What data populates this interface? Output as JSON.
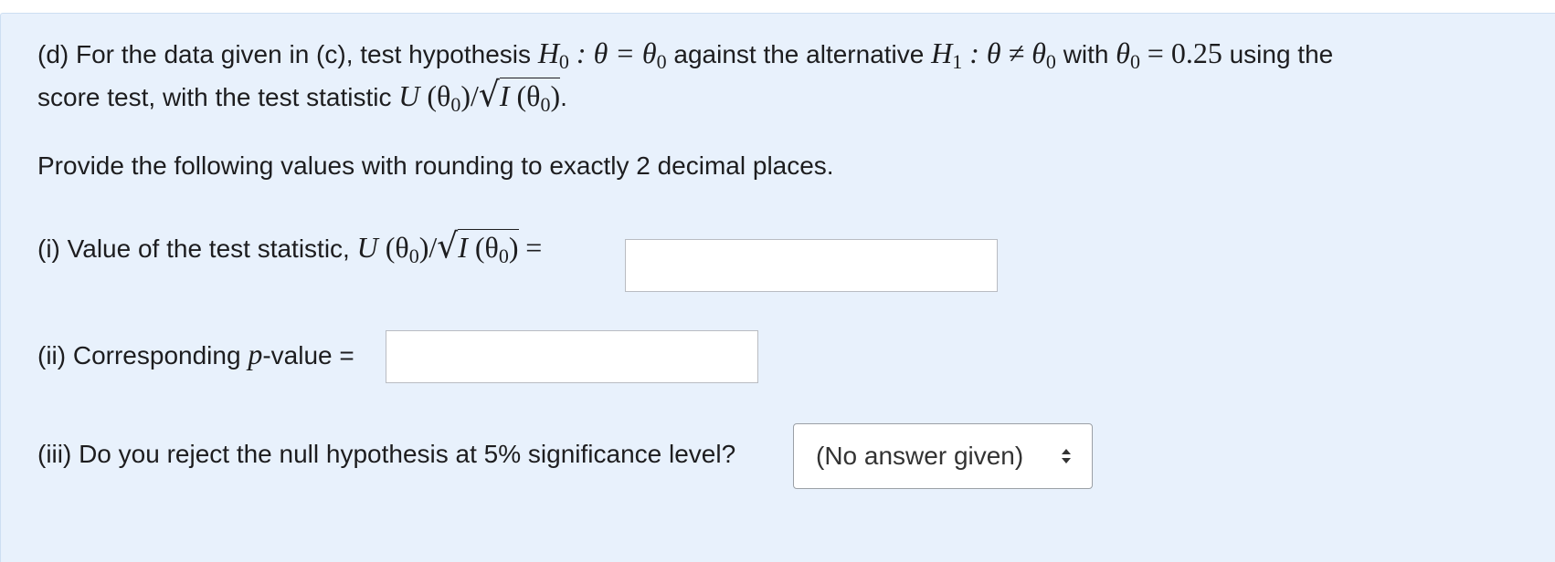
{
  "question": {
    "part_d_prefix": "(d) For the data given in (c), test hypothesis",
    "h0_symbol": "H",
    "h0_sub": "0",
    "h0_rel": " : θ = θ",
    "h0_theta_sub": "0",
    "against_text": "against the alternative",
    "h1_symbol": "H",
    "h1_sub": "1",
    "h1_rel": " : θ ≠ θ",
    "h1_theta_sub": "0",
    "with_text": "with",
    "theta0_symbol": "θ",
    "theta0_sub": "0",
    "theta0_value": "= 0.25",
    "using_text": "using the",
    "line2_text": "score test, with the test statistic",
    "stat_U": "U",
    "stat_theta_open": " (θ",
    "stat_theta_sub": "0",
    "stat_close_slash": ")/",
    "stat_I": "I",
    "stat_I_theta_open": " (θ",
    "stat_I_theta_sub": "0",
    "stat_I_close": ")",
    "line2_end": ".",
    "instruction": "Provide the following values with rounding to exactly 2 decimal places.",
    "item_i_label": "(i) Value of the test statistic,",
    "item_i_equals": "=",
    "item_i_value": "",
    "item_ii_prefix": "(ii) Corresponding",
    "item_ii_p": "p",
    "item_ii_suffix": "-value =",
    "item_ii_value": "",
    "item_iii_label": "(iii) Do you reject the null hypothesis at 5% significance level?",
    "item_iii_selected": "(No answer given)"
  }
}
